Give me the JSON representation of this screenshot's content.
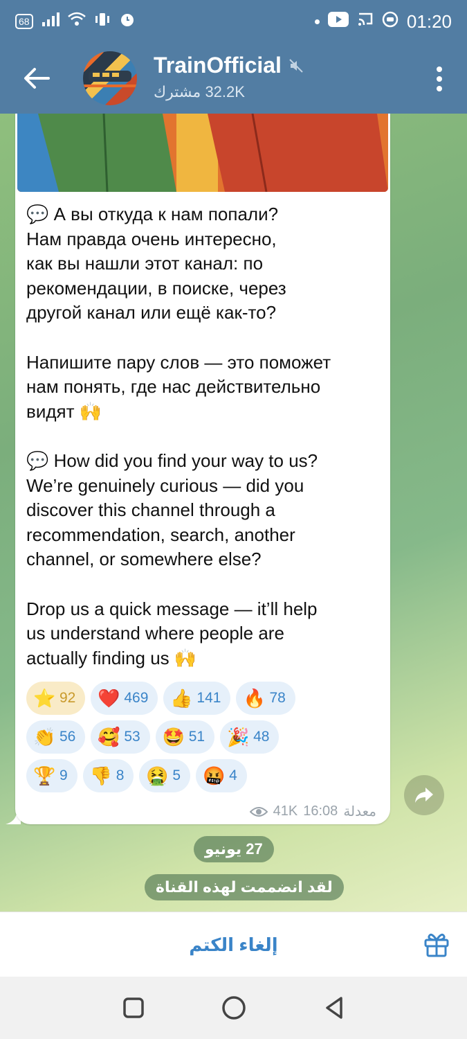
{
  "status_bar": {
    "network_badge": "68",
    "time": "01:20"
  },
  "header": {
    "channel_name": "TrainOfficial",
    "subscribers": "32.2K مشترك",
    "muted": true
  },
  "message": {
    "paragraphs": [
      "💬 А вы откуда к нам попали?\nНам правда очень интересно,\nкак вы нашли этот канал: по\nрекомендации, в поиске, через\nдругой канал или ещё как-то?",
      "Напишите пару слов — это поможет\nнам понять, где нас действительно\nвидят 🙌",
      "💬 How did you find your way to us?\nWe’re genuinely curious — did you\ndiscover this channel through a\nrecommendation, search, another\nchannel, or somewhere else?",
      "Drop us a quick message — it’ll help\nus understand where people are\nactually finding us 🙌"
    ],
    "reactions": [
      {
        "emoji": "⭐",
        "count": "92",
        "active": true
      },
      {
        "emoji": "❤️",
        "count": "469"
      },
      {
        "emoji": "👍",
        "count": "141"
      },
      {
        "emoji": "🔥",
        "count": "78"
      },
      {
        "emoji": "👏",
        "count": "56"
      },
      {
        "emoji": "🥰",
        "count": "53"
      },
      {
        "emoji": "🤩",
        "count": "51"
      },
      {
        "emoji": "🎉",
        "count": "48"
      },
      {
        "emoji": "🏆",
        "count": "9"
      },
      {
        "emoji": "👎",
        "count": "8"
      },
      {
        "emoji": "🤮",
        "count": "5"
      },
      {
        "emoji": "🤬",
        "count": "4"
      }
    ],
    "views": "41K",
    "time": "16:08",
    "edited_label": "معدلة"
  },
  "service": {
    "date": "27 يونيو",
    "joined": "لقد انضممت لهذه القناة"
  },
  "bottom": {
    "unmute_label": "إلغاء الكتم"
  },
  "colors": {
    "header_bg": "#527da3",
    "accent": "#3a84c8"
  }
}
